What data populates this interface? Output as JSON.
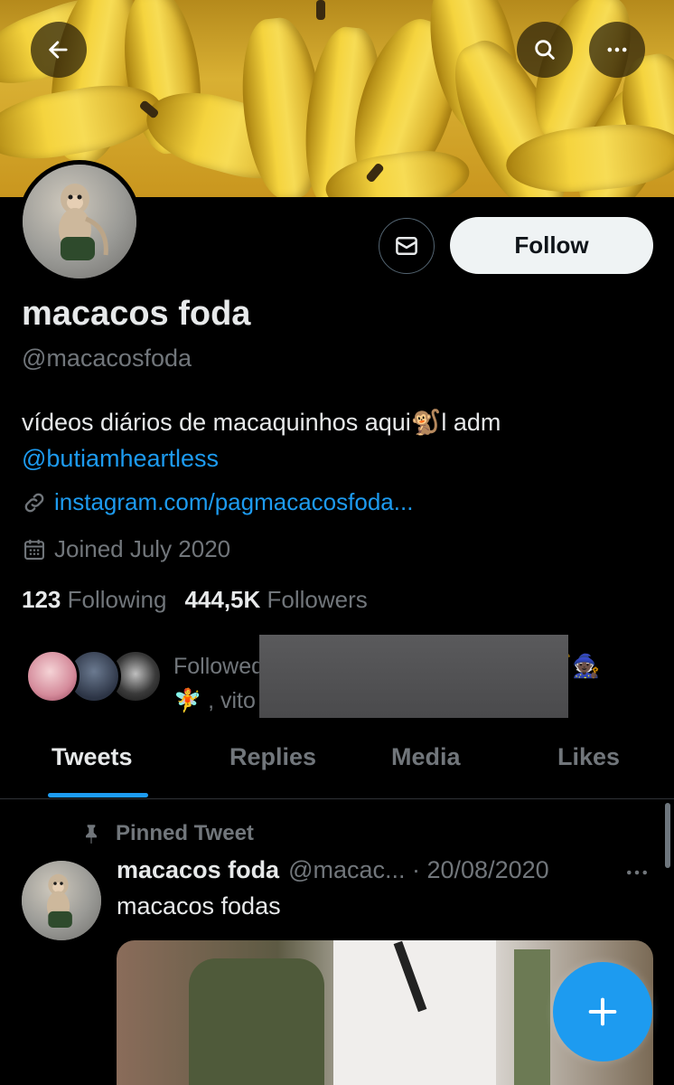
{
  "profile": {
    "name": "macacos foda",
    "handle": "@macacosfoda",
    "bio_text": "vídeos diários de macaquinhos aqui🐒l adm",
    "bio_mention": "@butiamheartless",
    "link": "instagram.com/pagmacacosfoda...",
    "joined": "Joined July 2020"
  },
  "actions": {
    "follow_label": "Follow"
  },
  "stats": {
    "following_count": "123",
    "following_label": "Following",
    "followers_count": "444,5K",
    "followers_label": "Followers"
  },
  "followed_by": {
    "line1": "Followed by                                     s 🗡️🧙🏿",
    "line2": "🧚 , vito                                       thers"
  },
  "tabs": [
    {
      "label": "Tweets",
      "active": true
    },
    {
      "label": "Replies",
      "active": false
    },
    {
      "label": "Media",
      "active": false
    },
    {
      "label": "Likes",
      "active": false
    }
  ],
  "pinned_tweet": {
    "pinned_label": "Pinned Tweet",
    "author_name": "macacos foda",
    "author_handle_date": "@macac... · 20/08/2020",
    "text": "macacos fodas"
  },
  "colors": {
    "accent": "#1d9bf0",
    "background": "#000000",
    "muted": "#71767b",
    "text": "#e7e9ea"
  },
  "icons": [
    "back-arrow-icon",
    "search-icon",
    "more-icon",
    "mail-icon",
    "link-icon",
    "calendar-icon",
    "pin-icon",
    "plus-icon"
  ]
}
